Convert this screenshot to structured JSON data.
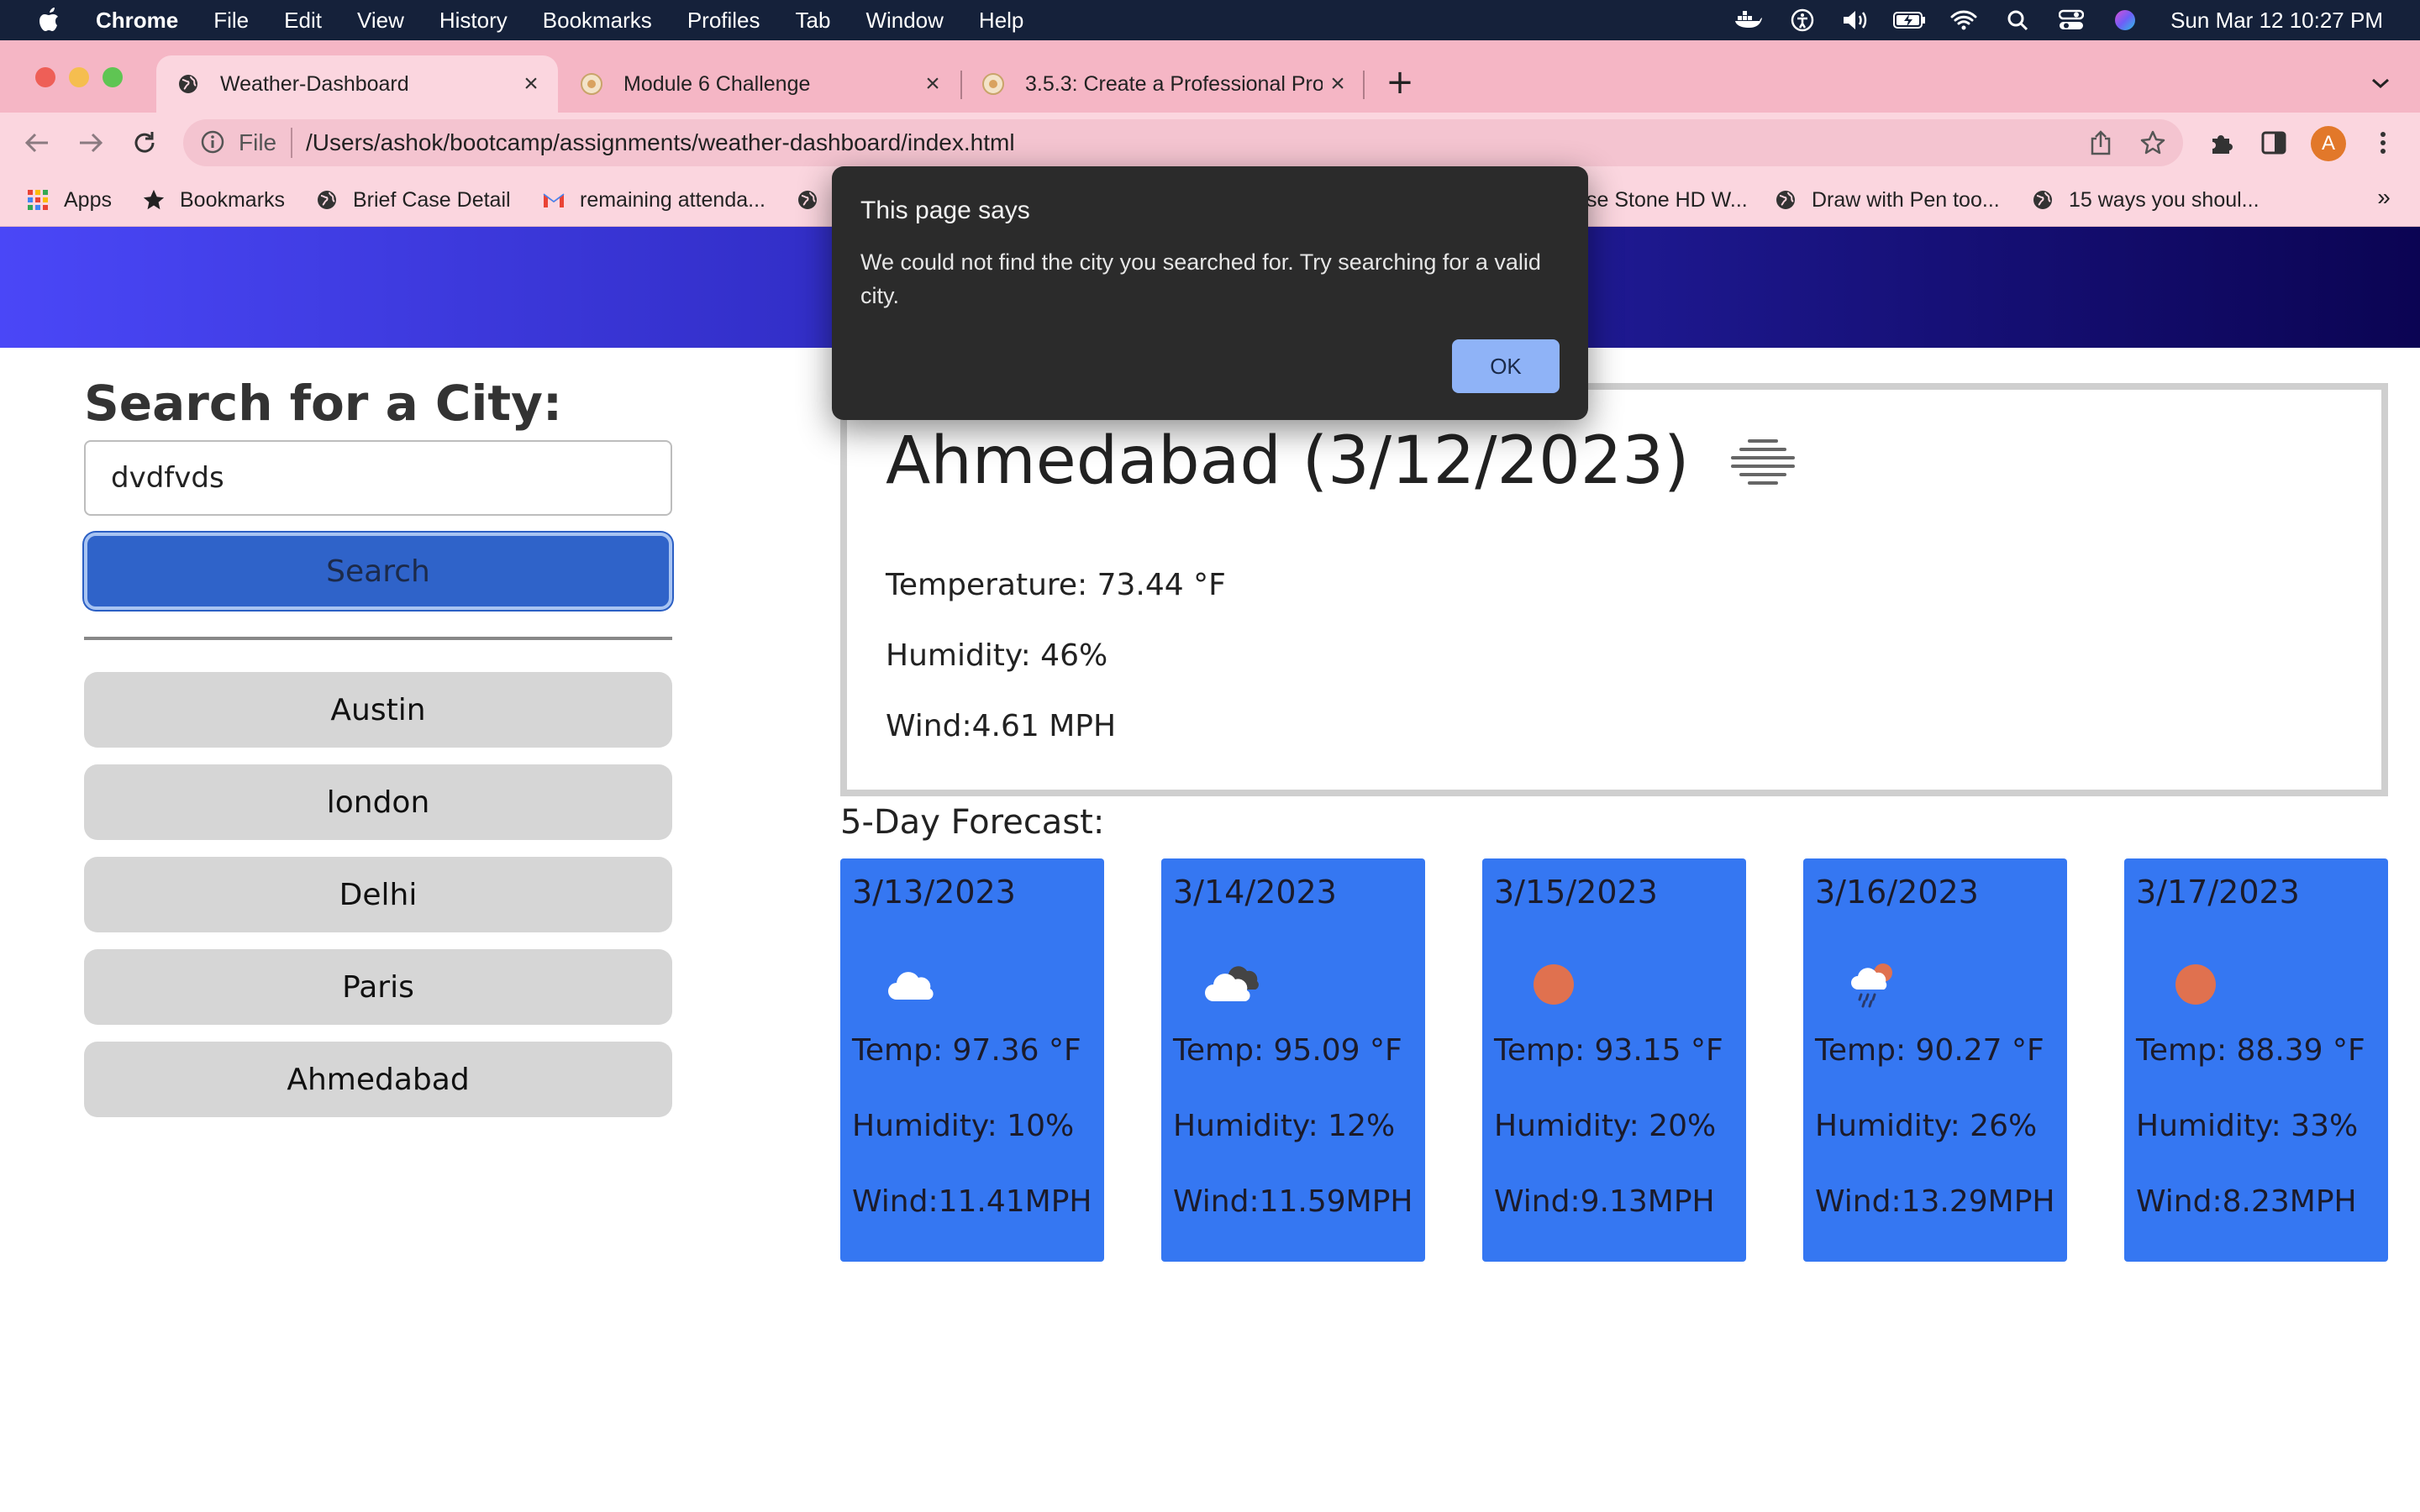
{
  "menubar": {
    "app_name": "Chrome",
    "items": [
      "File",
      "Edit",
      "View",
      "History",
      "Bookmarks",
      "Profiles",
      "Tab",
      "Window",
      "Help"
    ],
    "clock": "Sun Mar 12  10:27 PM"
  },
  "browser": {
    "tabs": [
      {
        "title": "Weather-Dashboard",
        "active": true
      },
      {
        "title": "Module 6 Challenge",
        "active": false
      },
      {
        "title": "3.5.3: Create a Professional Pro",
        "active": false
      }
    ],
    "address": {
      "scheme_label": "File",
      "url": "/Users/ashok/bootcamp/assignments/weather-dashboard/index.html"
    },
    "profile_initial": "A",
    "bookmarks": [
      "Apps",
      "Bookmarks",
      "Brief Case Detail",
      "remaining attenda...",
      "se Stone HD W...",
      "Draw with Pen too...",
      "15 ways you shoul..."
    ],
    "bookmarks_more": "»"
  },
  "page": {
    "search": {
      "title": "Search for a City:",
      "input_value": "dvdfvds",
      "button_label": "Search"
    },
    "history": [
      "Austin",
      "london",
      "Delhi",
      "Paris",
      "Ahmedabad"
    ],
    "current": {
      "title": "Ahmedabad (3/12/2023)",
      "icon": "mist-icon",
      "temperature": "Temperature: 73.44 °F",
      "humidity": "Humidity: 46%",
      "wind": "Wind:4.61 MPH"
    },
    "forecast_title": "5-Day Forecast:",
    "forecast": [
      {
        "date": "3/13/2023",
        "icon": "cloud-icon",
        "temp": "Temp: 97.36 °F",
        "humidity": "Humidity: 10%",
        "wind": "Wind:11.41MPH"
      },
      {
        "date": "3/14/2023",
        "icon": "broken-clouds-icon",
        "temp": "Temp: 95.09 °F",
        "humidity": "Humidity: 12%",
        "wind": "Wind:11.59MPH"
      },
      {
        "date": "3/15/2023",
        "icon": "sun-icon",
        "temp": "Temp: 93.15 °F",
        "humidity": "Humidity: 20%",
        "wind": "Wind:9.13MPH"
      },
      {
        "date": "3/16/2023",
        "icon": "rain-sun-icon",
        "temp": "Temp: 90.27 °F",
        "humidity": "Humidity: 26%",
        "wind": "Wind:13.29MPH"
      },
      {
        "date": "3/17/2023",
        "icon": "sun-icon",
        "temp": "Temp: 88.39 °F",
        "humidity": "Humidity: 33%",
        "wind": "Wind:8.23MPH"
      }
    ]
  },
  "dialog": {
    "title": "This page says",
    "message": "We could not find the city you searched for. Try searching for a valid city.",
    "ok_label": "OK"
  },
  "colors": {
    "banner_start": "#4a47f7",
    "banner_end": "#0b0453",
    "search_button": "#2f63c9",
    "forecast_card": "#3577f2",
    "sun": "#e0714f",
    "dialog_bg": "#2b2b2b",
    "dialog_ok": "#8fb3f7"
  }
}
